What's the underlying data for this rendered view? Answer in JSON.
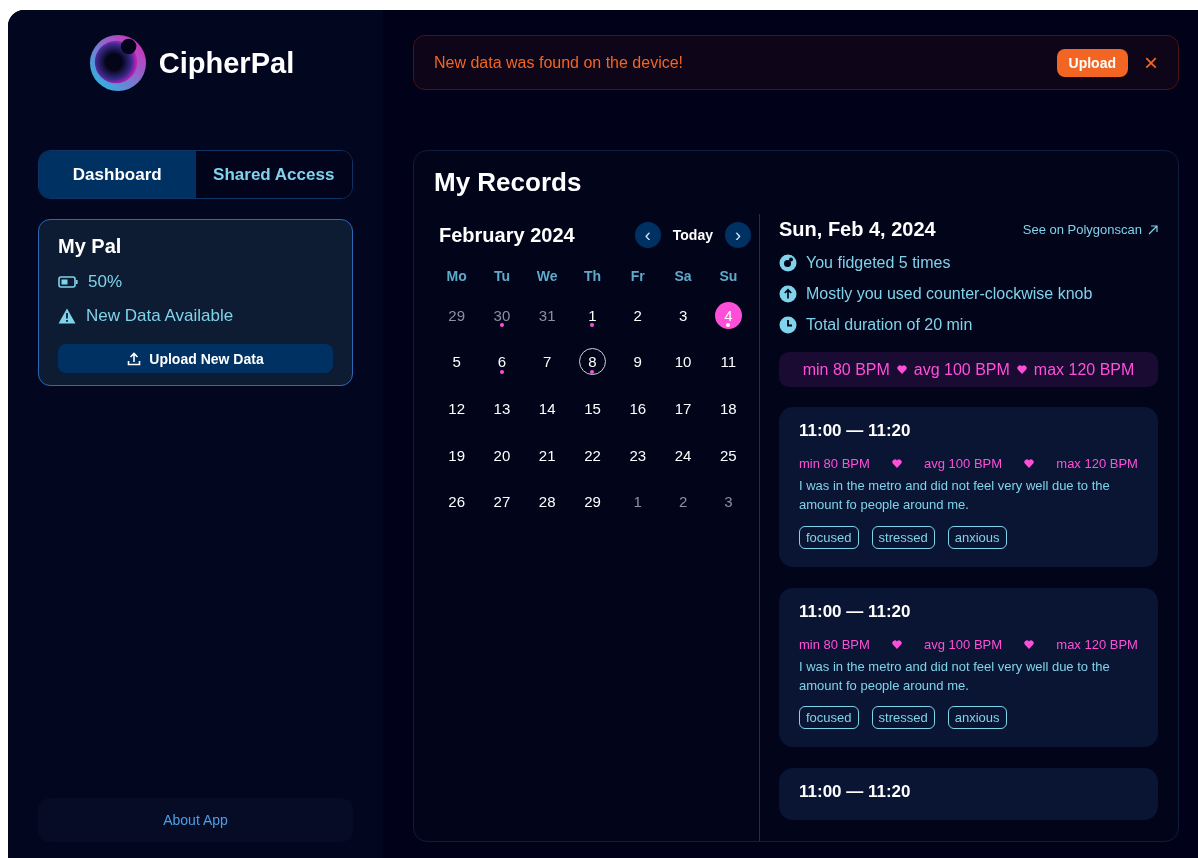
{
  "app": {
    "name": "CipherPal"
  },
  "tabs": [
    {
      "label": "Dashboard",
      "selected": true
    },
    {
      "label": "Shared Access",
      "selected": false
    }
  ],
  "device": {
    "title": "My Pal",
    "battery": "50%",
    "status": "New Data Available",
    "button": "Upload New Data"
  },
  "about": "About App",
  "banner": {
    "message": "New data was found on the device!",
    "button": "Upload",
    "close": "×"
  },
  "records": {
    "title": "My Records",
    "calendar": {
      "month": "February 2024",
      "prev": "‹",
      "today": "Today",
      "next": "›",
      "weekdays": [
        "Mo",
        "Tu",
        "We",
        "Th",
        "Fr",
        "Sa",
        "Su"
      ],
      "days": [
        {
          "label": "29",
          "outside": true,
          "dot": false,
          "today": false,
          "selected": false
        },
        {
          "label": "30",
          "outside": true,
          "dot": true,
          "today": false,
          "selected": false
        },
        {
          "label": "31",
          "outside": true,
          "dot": false,
          "today": false,
          "selected": false
        },
        {
          "label": "1",
          "outside": false,
          "dot": true,
          "today": false,
          "selected": false
        },
        {
          "label": "2",
          "outside": false,
          "dot": false,
          "today": false,
          "selected": false
        },
        {
          "label": "3",
          "outside": false,
          "dot": false,
          "today": false,
          "selected": false
        },
        {
          "label": "4",
          "outside": false,
          "dot": true,
          "today": false,
          "selected": true
        },
        {
          "label": "5",
          "outside": false,
          "dot": false,
          "today": false,
          "selected": false
        },
        {
          "label": "6",
          "outside": false,
          "dot": true,
          "today": false,
          "selected": false
        },
        {
          "label": "7",
          "outside": false,
          "dot": false,
          "today": false,
          "selected": false
        },
        {
          "label": "8",
          "outside": false,
          "dot": true,
          "today": true,
          "selected": false
        },
        {
          "label": "9",
          "outside": false,
          "dot": false,
          "today": false,
          "selected": false
        },
        {
          "label": "10",
          "outside": false,
          "dot": false,
          "today": false,
          "selected": false
        },
        {
          "label": "11",
          "outside": false,
          "dot": false,
          "today": false,
          "selected": false
        },
        {
          "label": "12",
          "outside": false,
          "dot": false,
          "today": false,
          "selected": false
        },
        {
          "label": "13",
          "outside": false,
          "dot": false,
          "today": false,
          "selected": false
        },
        {
          "label": "14",
          "outside": false,
          "dot": false,
          "today": false,
          "selected": false
        },
        {
          "label": "15",
          "outside": false,
          "dot": false,
          "today": false,
          "selected": false
        },
        {
          "label": "16",
          "outside": false,
          "dot": false,
          "today": false,
          "selected": false
        },
        {
          "label": "17",
          "outside": false,
          "dot": false,
          "today": false,
          "selected": false
        },
        {
          "label": "18",
          "outside": false,
          "dot": false,
          "today": false,
          "selected": false
        },
        {
          "label": "19",
          "outside": false,
          "dot": false,
          "today": false,
          "selected": false
        },
        {
          "label": "20",
          "outside": false,
          "dot": false,
          "today": false,
          "selected": false
        },
        {
          "label": "21",
          "outside": false,
          "dot": false,
          "today": false,
          "selected": false
        },
        {
          "label": "22",
          "outside": false,
          "dot": false,
          "today": false,
          "selected": false
        },
        {
          "label": "23",
          "outside": false,
          "dot": false,
          "today": false,
          "selected": false
        },
        {
          "label": "24",
          "outside": false,
          "dot": false,
          "today": false,
          "selected": false
        },
        {
          "label": "25",
          "outside": false,
          "dot": false,
          "today": false,
          "selected": false
        },
        {
          "label": "26",
          "outside": false,
          "dot": false,
          "today": false,
          "selected": false
        },
        {
          "label": "27",
          "outside": false,
          "dot": false,
          "today": false,
          "selected": false
        },
        {
          "label": "28",
          "outside": false,
          "dot": false,
          "today": false,
          "selected": false
        },
        {
          "label": "29",
          "outside": false,
          "dot": false,
          "today": false,
          "selected": false
        },
        {
          "label": "1",
          "outside": true,
          "dot": false,
          "today": false,
          "selected": false
        },
        {
          "label": "2",
          "outside": true,
          "dot": false,
          "today": false,
          "selected": false
        },
        {
          "label": "3",
          "outside": true,
          "dot": false,
          "today": false,
          "selected": false
        }
      ]
    },
    "day": {
      "date": "Sun, Feb 4, 2024",
      "link": "See on Polygonscan",
      "stats": [
        {
          "kind": "fidget",
          "text": "You fidgeted 5 times"
        },
        {
          "kind": "direction",
          "text": "Mostly you used counter-clockwise knob"
        },
        {
          "kind": "duration",
          "text": "Total duration of 20 min"
        }
      ],
      "bpm": [
        "min 80 BPM",
        "avg 100 BPM",
        "max 120 BPM"
      ]
    },
    "entries": [
      {
        "time": "11:00 — 11:20",
        "bpm": [
          "min 80 BPM",
          "avg 100 BPM",
          "max 120 BPM"
        ],
        "note": "I was in the metro and did not feel very well due to the amount fo people around me.",
        "tags": [
          "focused",
          "stressed",
          "anxious"
        ]
      },
      {
        "time": "11:00 — 11:20",
        "bpm": [
          "min 80 BPM",
          "avg 100 BPM",
          "max 120 BPM"
        ],
        "note": "I was in the metro and did not feel very well due to the amount fo people around me.",
        "tags": [
          "focused",
          "stressed",
          "anxious"
        ]
      },
      {
        "time": "11:00 — 11:20"
      }
    ]
  }
}
